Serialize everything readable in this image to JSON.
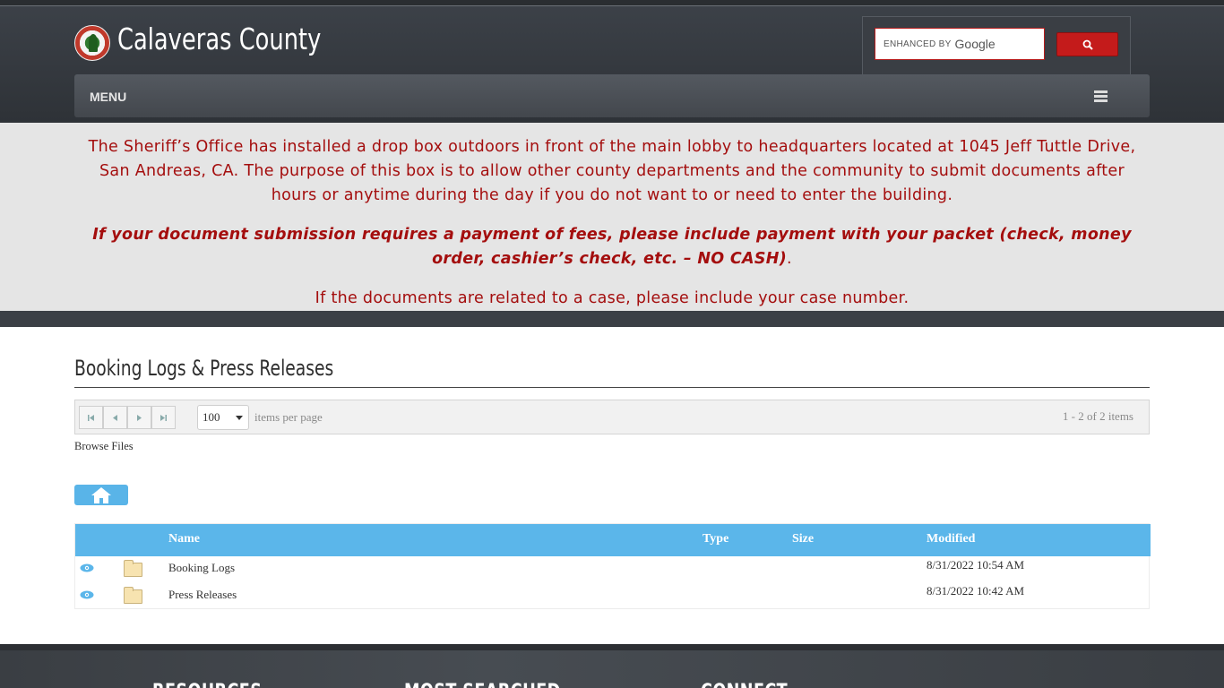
{
  "header": {
    "site_title": "Calaveras County",
    "search": {
      "enhanced_by": "ENHANCED BY",
      "google": "Google"
    },
    "menu_label": "MENU"
  },
  "alert": {
    "p1": "The Sheriff’s Office has installed a drop box outdoors in front of the main lobby to headquarters located at 1045 Jeff Tuttle Drive, San Andreas, CA. The purpose of this box is to allow other county departments and the community to submit documents after hours or anytime during the day if you do not want to or need to enter the building.",
    "p2": "If your document submission requires a payment of fees, please include payment with your packet (check, money order, cashier’s check, etc. – NO CASH)",
    "p2_end": ".",
    "p3": "If the documents are related to a case, please include your case number."
  },
  "main": {
    "page_title": "Booking Logs & Press Releases",
    "pager": {
      "per_page_value": "100",
      "per_page_label": "items per page",
      "count": "1 - 2 of 2 items"
    },
    "browse_label": "Browse Files",
    "columns": {
      "name": "Name",
      "type": "Type",
      "size": "Size",
      "modified": "Modified"
    },
    "rows": [
      {
        "name": "Booking Logs",
        "type": "",
        "size": "",
        "modified": "8/31/2022 10:54 AM"
      },
      {
        "name": "Press Releases",
        "type": "",
        "size": "",
        "modified": "8/31/2022 10:42 AM"
      }
    ]
  },
  "footer": {
    "col1": "RESOURCES",
    "col2": "MOST SEARCHED",
    "col3": "CONNECT"
  },
  "colors": {
    "accent_blue": "#5bb6ea",
    "alert_red": "#a40e0e",
    "search_red": "#c41b1b"
  }
}
